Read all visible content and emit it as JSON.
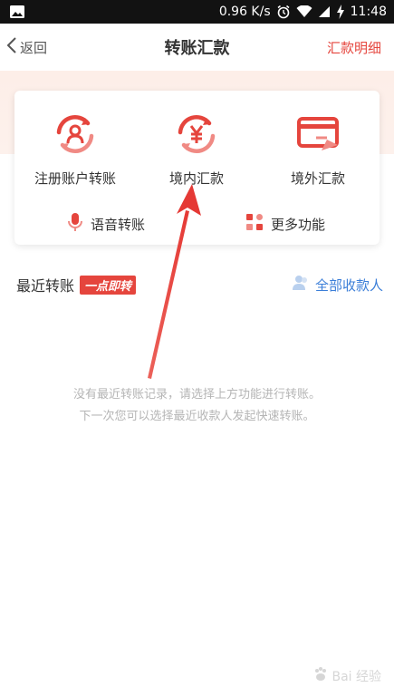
{
  "status_bar": {
    "speed": "0.96 K/s",
    "time": "11:48"
  },
  "nav": {
    "back_label": "返回",
    "title": "转账汇款",
    "right_label": "汇款明细"
  },
  "functions": [
    {
      "label": "注册账户转账",
      "icon": "account-transfer-icon"
    },
    {
      "label": "境内汇款",
      "icon": "yuan-exchange-icon"
    },
    {
      "label": "境外汇款",
      "icon": "overseas-card-icon"
    }
  ],
  "sub_functions": [
    {
      "label": "语音转账",
      "icon": "microphone-icon"
    },
    {
      "label": "更多功能",
      "icon": "grid-icon"
    }
  ],
  "recent": {
    "title": "最近转账",
    "badge": "一点即转",
    "all_payees": "全部收款人"
  },
  "empty_hint": {
    "line1": "没有最近转账记录，请选择上方功能进行转账。",
    "line2": "下一次您可以选择最近收款人发起快速转账。"
  },
  "watermark": "Bai 经验",
  "colors": {
    "accent_red": "#e5453d",
    "link_blue": "#3b7ed8"
  }
}
